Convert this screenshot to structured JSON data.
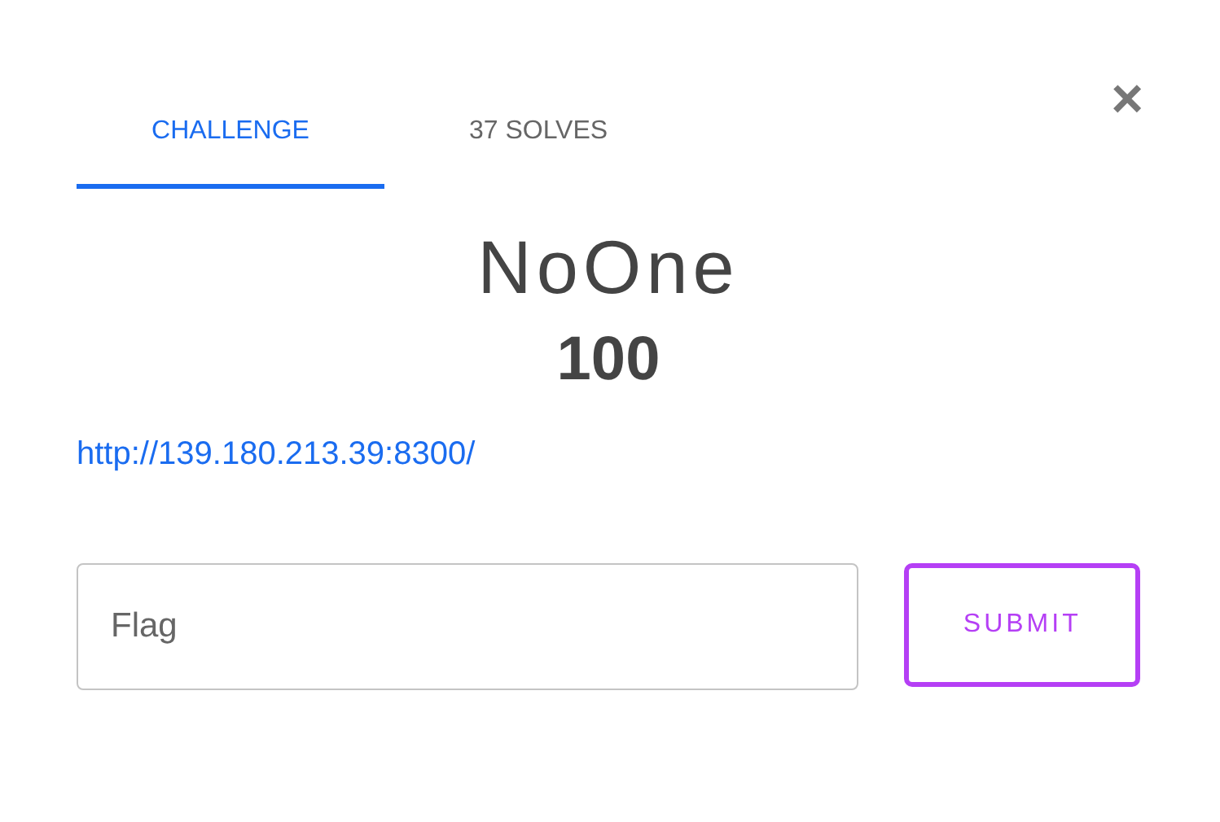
{
  "tabs": [
    {
      "label": "CHALLENGE",
      "selected": true
    },
    {
      "label": "37 SOLVES",
      "selected": false
    }
  ],
  "close": "×",
  "challenge": {
    "name": "NoOne",
    "points": "100",
    "link": "http://139.180.213.39:8300/"
  },
  "flag_field": {
    "placeholder": "Flag"
  },
  "submit": "SUBMIT"
}
